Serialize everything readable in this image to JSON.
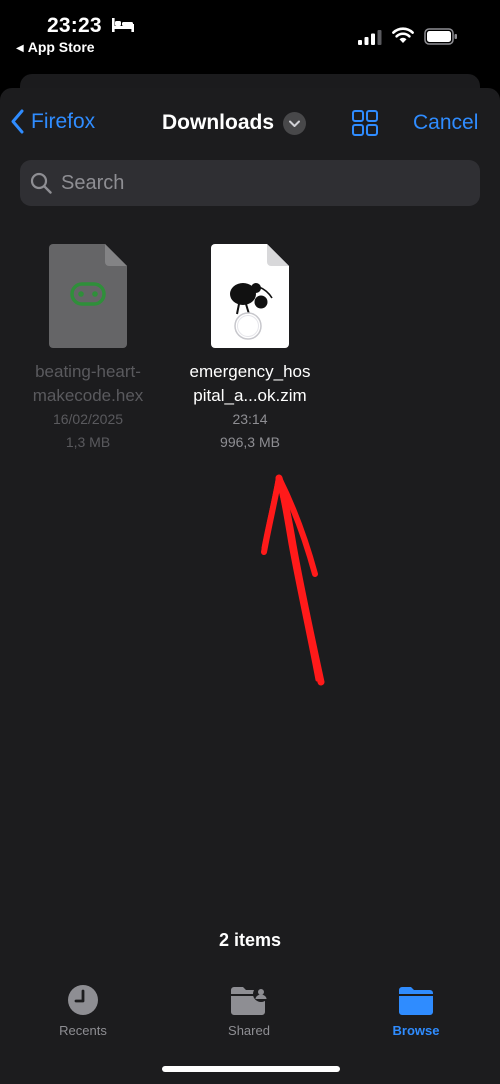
{
  "status_bar": {
    "time": "23:23",
    "back_app": "App Store",
    "icons": [
      "bed-icon",
      "signal-icon",
      "wifi-icon",
      "battery-icon"
    ]
  },
  "nav": {
    "back_label": "Firefox",
    "title": "Downloads",
    "cancel_label": "Cancel",
    "accent_color": "#2f8cff"
  },
  "search": {
    "placeholder": "Search"
  },
  "files": [
    {
      "name_line1": "beating-heart-",
      "name_line2": "makecode.hex",
      "date": "16/02/2025",
      "size": "1,3 MB",
      "icon": "hex-file-icon",
      "dimmed": true
    },
    {
      "name_line1": "emergency_hos",
      "name_line2": "pital_a...ok.zim",
      "date": "23:14",
      "size": "996,3 MB",
      "icon": "kiwix-zim-icon",
      "dimmed": false
    }
  ],
  "item_count": "2 items",
  "tabbar": {
    "items": [
      {
        "label": "Recents",
        "icon": "clock-icon",
        "active": false
      },
      {
        "label": "Shared",
        "icon": "shared-folder-icon",
        "active": false
      },
      {
        "label": "Browse",
        "icon": "folder-icon",
        "active": true
      }
    ]
  }
}
